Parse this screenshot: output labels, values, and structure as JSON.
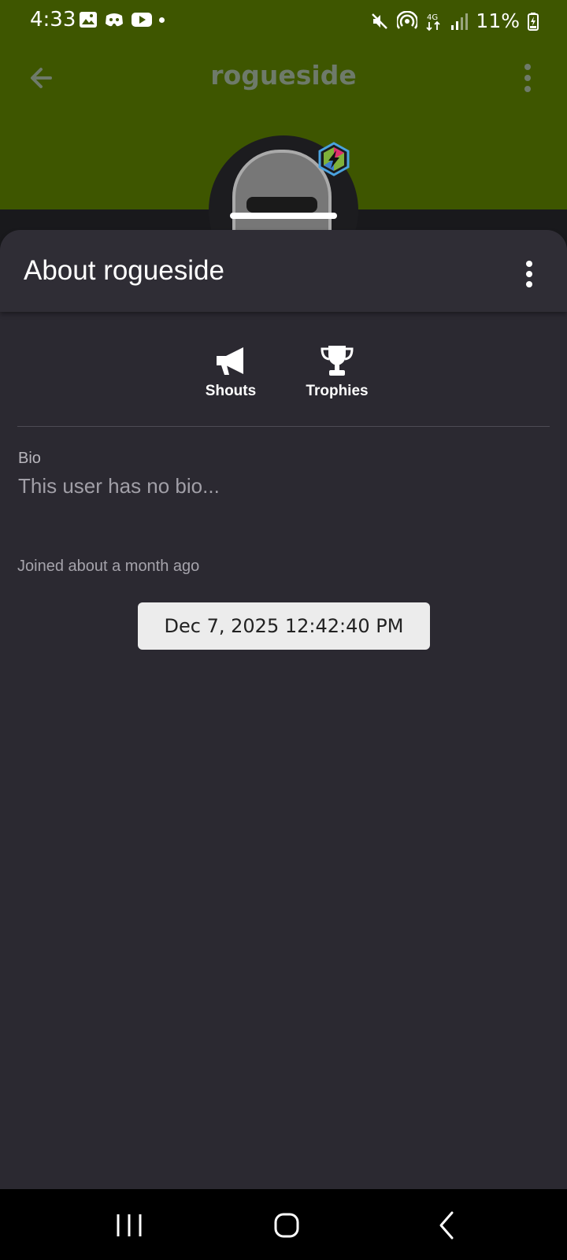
{
  "status_bar": {
    "time": "4:33",
    "battery": "11%",
    "network": "4G"
  },
  "app_bar": {
    "title": "rogueside",
    "back_icon": "arrow-left-icon",
    "menu_icon": "more-vertical-icon"
  },
  "colors": {
    "header_green": "#3e5600",
    "sheet_bg": "#2b2931",
    "chip_bg": "#ececec"
  },
  "sheet": {
    "title": "About rogueside",
    "menu_icon": "more-vertical-icon",
    "actions": [
      {
        "label": "Shouts",
        "icon": "megaphone-icon"
      },
      {
        "label": "Trophies",
        "icon": "trophy-icon"
      }
    ],
    "bio_label": "Bio",
    "bio_text": "This user has no bio...",
    "joined": "Joined about a month ago",
    "joined_date": "Dec 7, 2025 12:42:40 PM"
  }
}
